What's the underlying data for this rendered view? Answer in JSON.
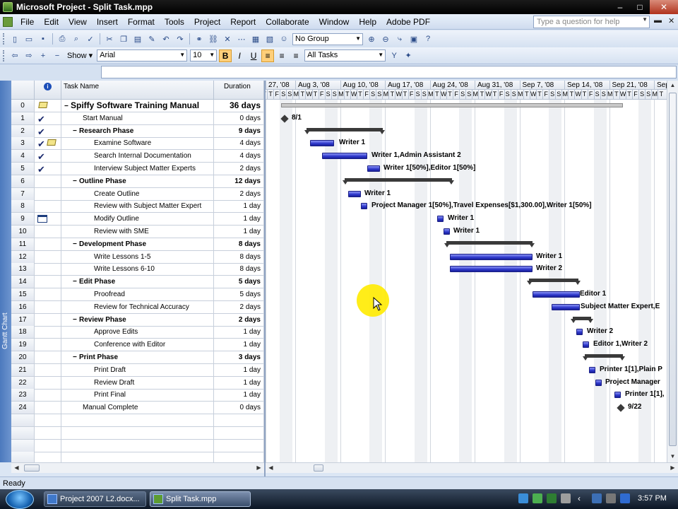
{
  "window": {
    "title": "Microsoft Project - Split Task.mpp",
    "minimize_label": "–",
    "maximize_label": "□",
    "close_label": "✕"
  },
  "menu": {
    "items": [
      "File",
      "Edit",
      "View",
      "Insert",
      "Format",
      "Tools",
      "Project",
      "Report",
      "Collaborate",
      "Window",
      "Help",
      "Adobe PDF"
    ],
    "help_placeholder": "Type a question for help"
  },
  "toolbar": {
    "group_value": "No Group",
    "show_label": "Show",
    "font_value": "Arial",
    "font_size": "10",
    "bold_label": "B",
    "italic_label": "I",
    "underline_label": "U",
    "filter_value": "All Tasks"
  },
  "viewbar": {
    "label": "Gantt Chart"
  },
  "table": {
    "header_name": "Task Name",
    "header_duration": "Duration",
    "rows": [
      {
        "id": "0",
        "name": "Spiffy Software Training Manual",
        "dur": "36 days",
        "level": 0,
        "summary": true,
        "project": true,
        "check": false,
        "note": true,
        "cal": false
      },
      {
        "id": "1",
        "name": "Start Manual",
        "dur": "0 days",
        "level": 1,
        "summary": false,
        "check": true
      },
      {
        "id": "2",
        "name": "Research Phase",
        "dur": "9 days",
        "level": 1,
        "summary": true,
        "check": true
      },
      {
        "id": "3",
        "name": "Examine Software",
        "dur": "4 days",
        "level": 2,
        "summary": false,
        "check": true,
        "note": true
      },
      {
        "id": "4",
        "name": "Search Internal Documentation",
        "dur": "4 days",
        "level": 2,
        "summary": false,
        "check": true
      },
      {
        "id": "5",
        "name": "Interview Subject Matter Experts",
        "dur": "2 days",
        "level": 2,
        "summary": false,
        "check": true
      },
      {
        "id": "6",
        "name": "Outline Phase",
        "dur": "12 days",
        "level": 1,
        "summary": true
      },
      {
        "id": "7",
        "name": "Create Outline",
        "dur": "2 days",
        "level": 2,
        "summary": false
      },
      {
        "id": "8",
        "name": "Review with Subject Matter Expert",
        "dur": "1 day",
        "level": 2,
        "summary": false
      },
      {
        "id": "9",
        "name": "Modify Outline",
        "dur": "1 day",
        "level": 2,
        "summary": false,
        "cal": true
      },
      {
        "id": "10",
        "name": "Review with SME",
        "dur": "1 day",
        "level": 2,
        "summary": false
      },
      {
        "id": "11",
        "name": "Development Phase",
        "dur": "8 days",
        "level": 1,
        "summary": true
      },
      {
        "id": "12",
        "name": "Write Lessons 1-5",
        "dur": "8 days",
        "level": 2,
        "summary": false
      },
      {
        "id": "13",
        "name": "Write Lessons 6-10",
        "dur": "8 days",
        "level": 2,
        "summary": false
      },
      {
        "id": "14",
        "name": "Edit Phase",
        "dur": "5 days",
        "level": 1,
        "summary": true
      },
      {
        "id": "15",
        "name": "Proofread",
        "dur": "5 days",
        "level": 2,
        "summary": false
      },
      {
        "id": "16",
        "name": "Review for Technical Accuracy",
        "dur": "2 days",
        "level": 2,
        "summary": false
      },
      {
        "id": "17",
        "name": "Review Phase",
        "dur": "2 days",
        "level": 1,
        "summary": true
      },
      {
        "id": "18",
        "name": "Approve Edits",
        "dur": "1 day",
        "level": 2,
        "summary": false
      },
      {
        "id": "19",
        "name": "Conference with Editor",
        "dur": "1 day",
        "level": 2,
        "summary": false
      },
      {
        "id": "20",
        "name": "Print Phase",
        "dur": "3 days",
        "level": 1,
        "summary": true
      },
      {
        "id": "21",
        "name": "Print Draft",
        "dur": "1 day",
        "level": 2,
        "summary": false
      },
      {
        "id": "22",
        "name": "Review Draft",
        "dur": "1 day",
        "level": 2,
        "summary": false
      },
      {
        "id": "23",
        "name": "Print Final",
        "dur": "1 day",
        "level": 2,
        "summary": false
      },
      {
        "id": "24",
        "name": "Manual Complete",
        "dur": "0 days",
        "level": 1,
        "summary": false
      }
    ]
  },
  "timescale": {
    "weeks": [
      "27, '08",
      "Aug 3, '08",
      "Aug 10, '08",
      "Aug 17, '08",
      "Aug 24, '08",
      "Aug 31, '08",
      "Sep 7, '08",
      "Sep 14, '08",
      "Sep 21, '08",
      "Sep"
    ],
    "days": [
      "T",
      "T",
      "F",
      "S",
      "S",
      "M",
      "T",
      "W",
      "T",
      "F",
      "S",
      "S",
      "M",
      "T",
      "W",
      "T",
      "F",
      "S",
      "S",
      "M",
      "T",
      "W",
      "T",
      "F",
      "S",
      "S",
      "M",
      "T",
      "W",
      "T",
      "F",
      "S",
      "S",
      "M",
      "T",
      "W",
      "T",
      "F",
      "S",
      "S",
      "M",
      "T",
      "W",
      "T",
      "F",
      "S",
      "S",
      "M",
      "T",
      "W",
      "T",
      "F",
      "S",
      "S",
      "M",
      "T",
      "W",
      "T",
      "F",
      "S",
      "S",
      "M",
      "T"
    ]
  },
  "gantt": {
    "labels": {
      "r1": "8/1",
      "r3": "Writer 1",
      "r4": "Writer 1,Admin Assistant 2",
      "r5": "Writer 1[50%],Editor 1[50%]",
      "r7": "Writer 1",
      "r8": "Project Manager 1[50%],Travel Expenses[$1,300.00],Writer 1[50%]",
      "r9": "Writer 1",
      "r10": "Writer 1",
      "r12": "Writer 1",
      "r13": "Writer 2",
      "r15": "Editor 1",
      "r16": "Subject Matter Expert,E",
      "r18": "Writer 2",
      "r19": "Editor 1,Writer 2",
      "r21": "Printer 1[1],Plain P",
      "r22": "Project Manager",
      "r23": "Printer 1[1],",
      "r24": "9/22"
    }
  },
  "status": {
    "text": "Ready"
  },
  "taskbar": {
    "tasks": [
      "Project 2007 L2.docx...",
      "Split Task.mpp"
    ],
    "clock": "3:57 PM"
  }
}
